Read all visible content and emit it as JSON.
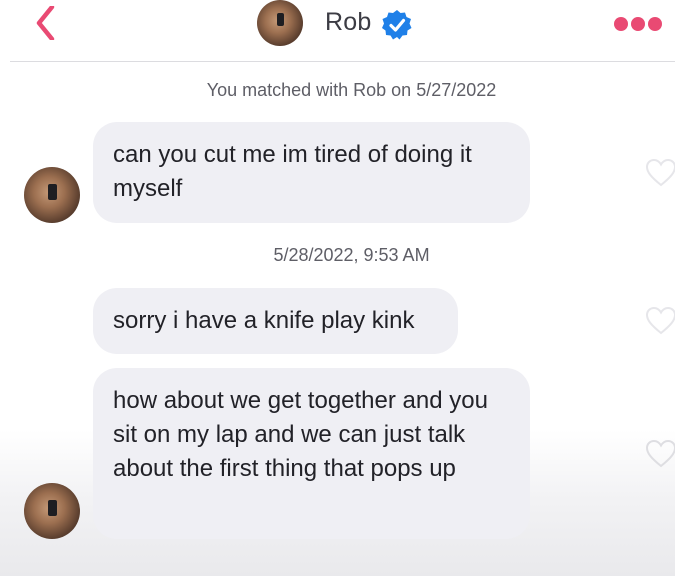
{
  "header": {
    "name": "Rob",
    "verified": true,
    "icons": {
      "back": "chevron-left-icon",
      "verified": "verified-badge-icon",
      "more": "more-dots-icon"
    },
    "accent_color": "#e94a73",
    "verified_color": "#1f80e8"
  },
  "match_note": "You matched with Rob on 5/27/2022",
  "messages": [
    {
      "text": "can you cut me im tired of doing it myself",
      "liked": false
    },
    {
      "timestamp": "5/28/2022, 9:53 AM"
    },
    {
      "text": "sorry i have a knife play kink",
      "liked": false
    },
    {
      "text": "how about we get together and you sit on my lap and we can just talk about the first thing that pops up",
      "liked": false
    }
  ]
}
